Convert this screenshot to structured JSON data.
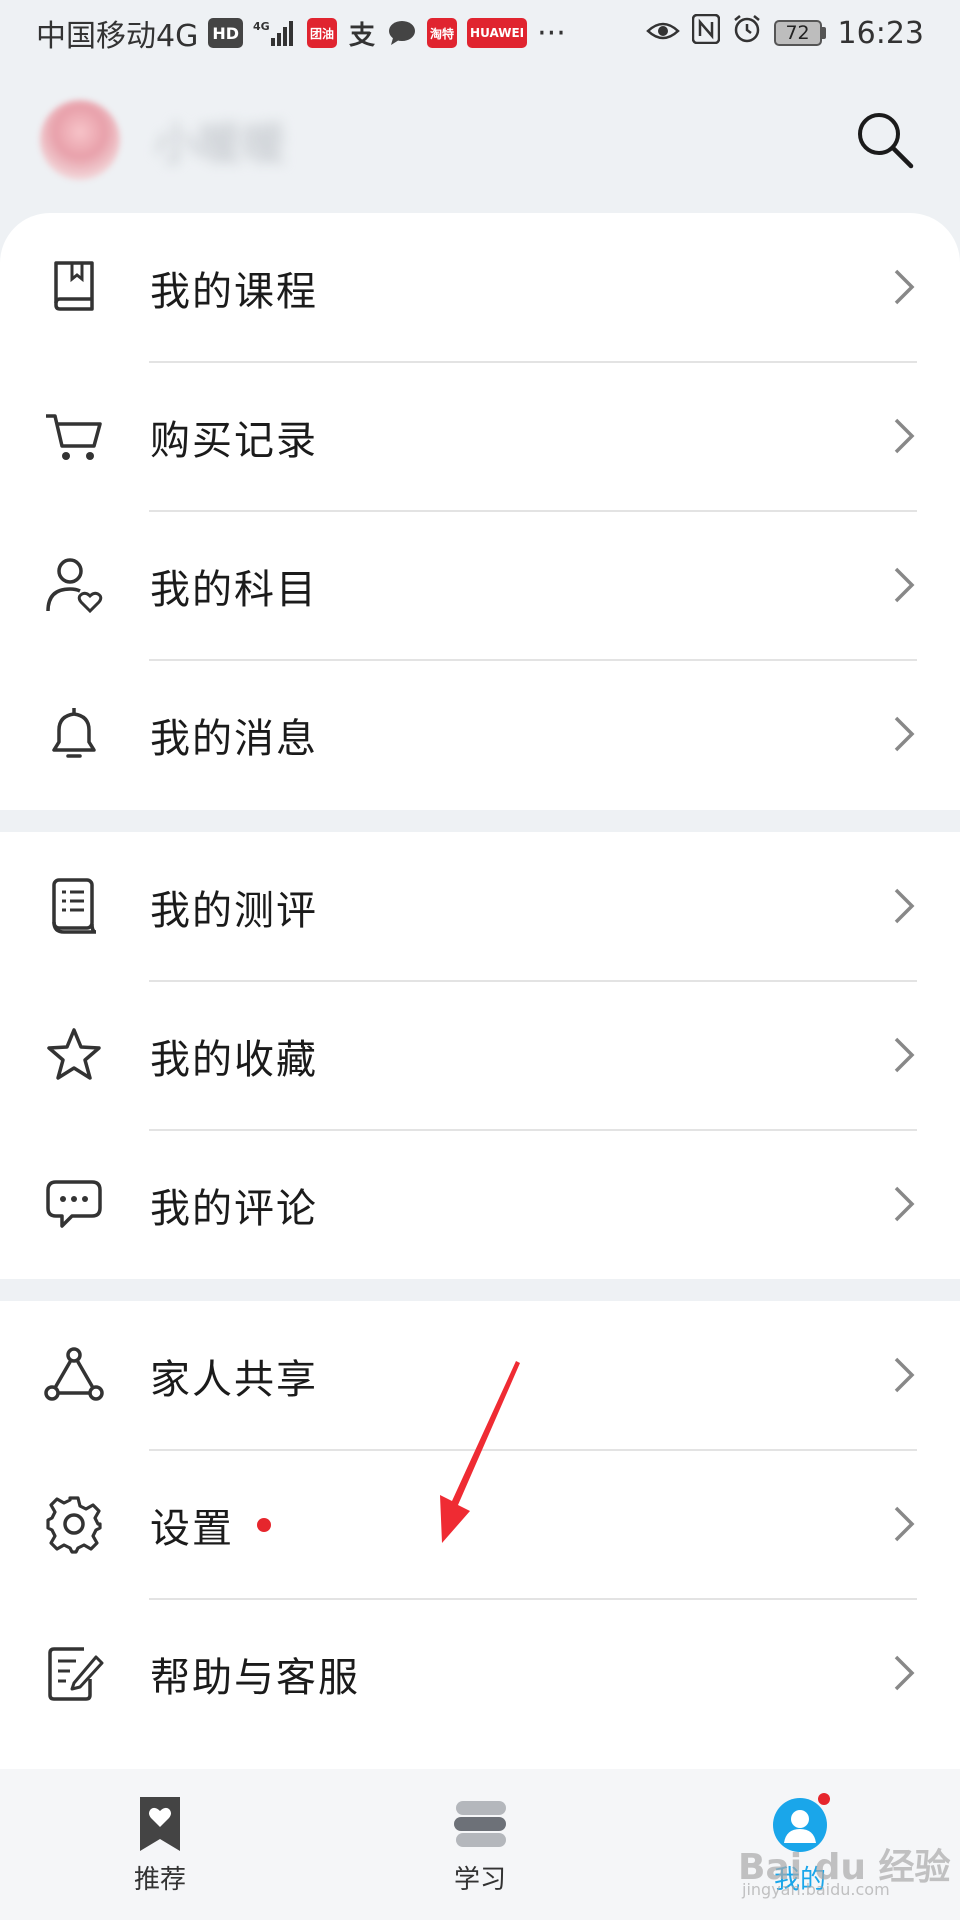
{
  "status_bar": {
    "carrier": "中国移动4G",
    "hd": "HD",
    "net": "4G",
    "app_badges": [
      "团油",
      "淘特",
      "HUAWEI"
    ],
    "alipay_glyph": "支",
    "more": "···",
    "battery": "72",
    "time": "16:23"
  },
  "header": {
    "username": "小暖暖"
  },
  "menu_groups": [
    [
      {
        "label": "我的课程",
        "icon": "book-icon"
      },
      {
        "label": "购买记录",
        "icon": "cart-icon"
      },
      {
        "label": "我的科目",
        "icon": "person-heart-icon"
      },
      {
        "label": "我的消息",
        "icon": "bell-icon"
      }
    ],
    [
      {
        "label": "我的测评",
        "icon": "list-document-icon"
      },
      {
        "label": "我的收藏",
        "icon": "star-icon"
      },
      {
        "label": "我的评论",
        "icon": "chat-bubble-icon"
      }
    ],
    [
      {
        "label": "家人共享",
        "icon": "triangle-nodes-icon"
      },
      {
        "label": "设置",
        "icon": "gear-icon"
      },
      {
        "label": "帮助与客服",
        "icon": "edit-note-icon"
      }
    ]
  ],
  "tabs": [
    {
      "label": "推荐",
      "icon": "bookmark-heart-icon"
    },
    {
      "label": "学习",
      "icon": "books-stack-icon"
    },
    {
      "label": "我的",
      "icon": "user-profile-icon"
    }
  ],
  "watermark": {
    "text": "Bai du 经验",
    "sub": "jingyan.baidu.com"
  },
  "colors": {
    "accent": "#1aa6ea",
    "notice_red": "#e6262d",
    "page_bg": "#eef1f4"
  }
}
